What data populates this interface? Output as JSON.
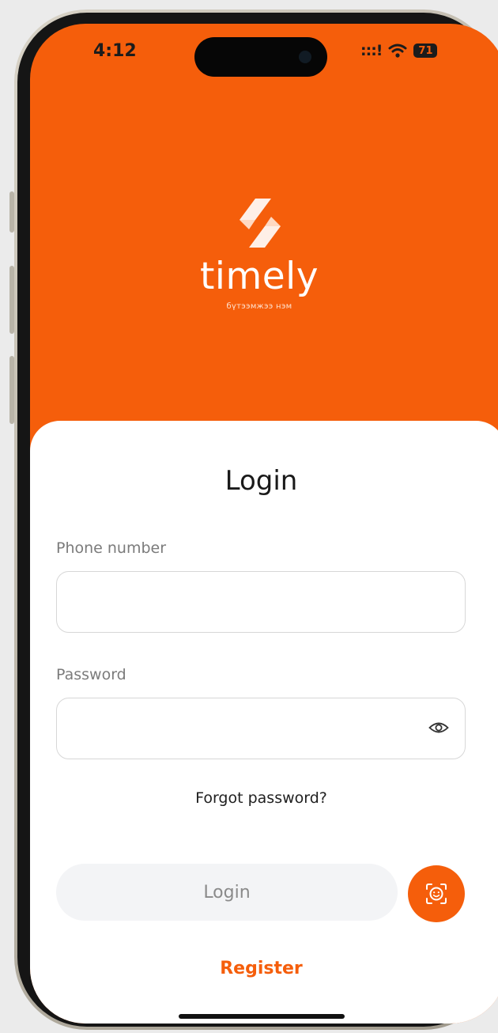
{
  "status_bar": {
    "time": "4:12",
    "signal": ":::!",
    "battery": "71"
  },
  "brand": {
    "name": "timely",
    "tagline": "бүтээмжээ нэм"
  },
  "login": {
    "title": "Login",
    "phone_label": "Phone number",
    "phone_value": "",
    "password_label": "Password",
    "password_value": "",
    "forgot_label": "Forgot password?",
    "submit_label": "Login",
    "register_label": "Register"
  },
  "icons": {
    "password_toggle": "eye-icon",
    "biometric": "face-id-icon",
    "logo": "timely-logo-mark"
  },
  "colors": {
    "brand_orange": "#f55e0b",
    "card_bg": "#ffffff",
    "login_button_bg": "#f3f4f6",
    "login_button_text": "#8a8a8a"
  }
}
